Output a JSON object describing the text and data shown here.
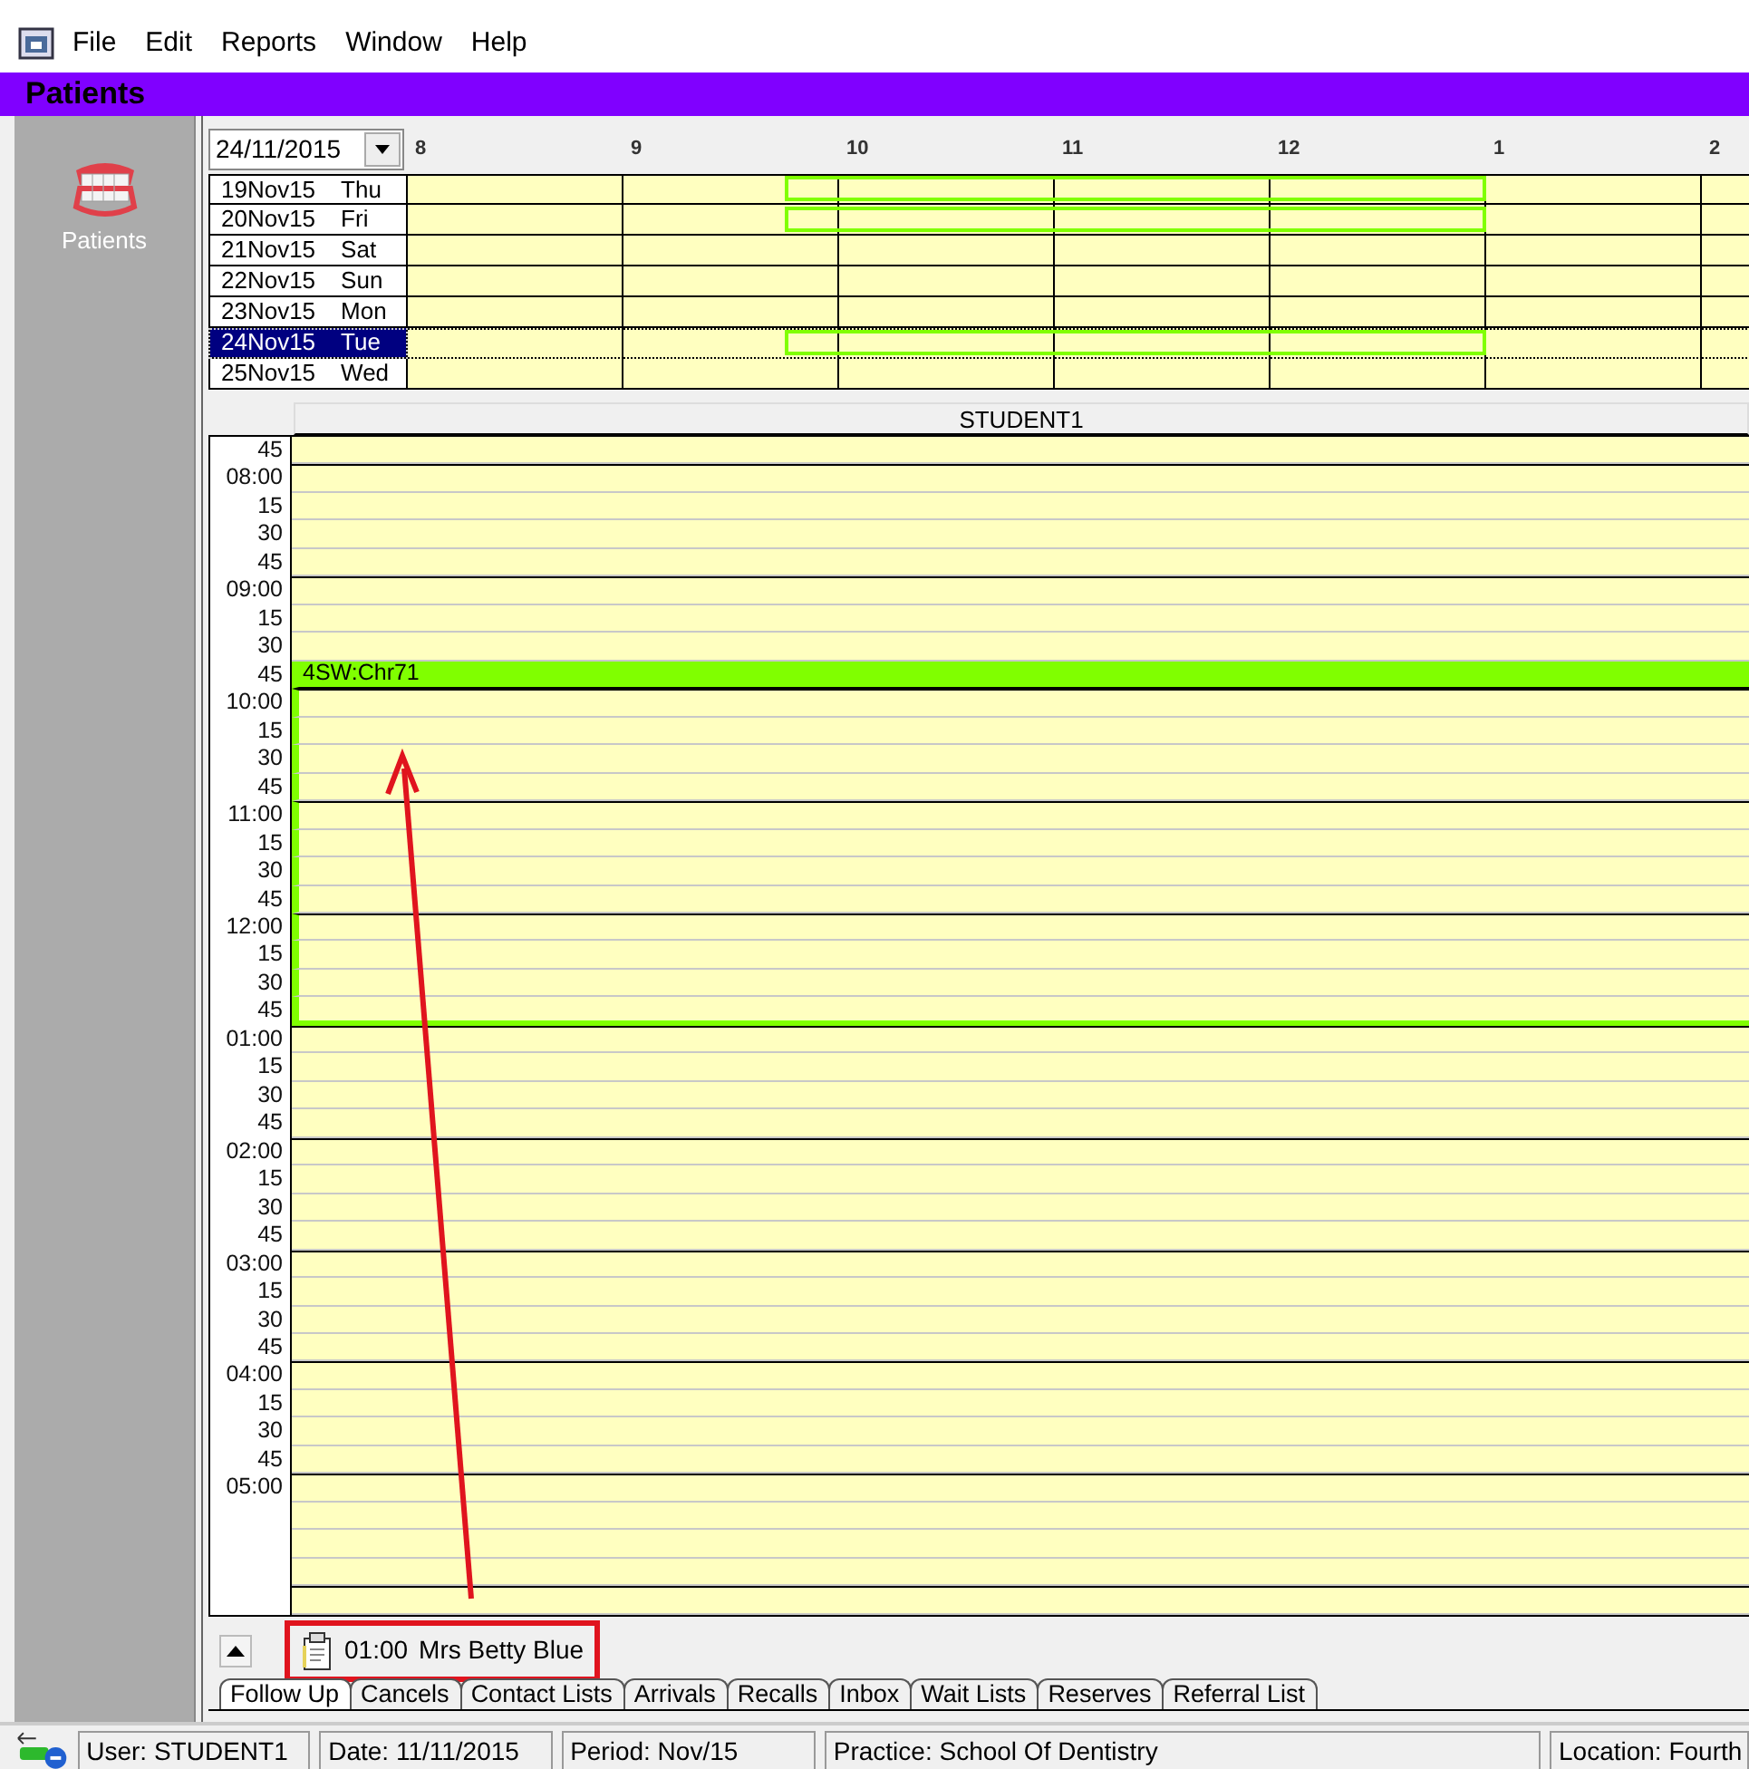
{
  "menu": [
    "File",
    "Edit",
    "Reports",
    "Window",
    "Help"
  ],
  "title": "Patients",
  "sidebar": {
    "items": [
      {
        "label": "Patients"
      }
    ]
  },
  "date_picker": {
    "value": "24/11/2015"
  },
  "hours": [
    "8",
    "9",
    "10",
    "11",
    "12",
    "1",
    "2"
  ],
  "days": [
    {
      "date": "19Nov15",
      "weekday": "Thu",
      "selected": false,
      "booked": true
    },
    {
      "date": "20Nov15",
      "weekday": "Fri",
      "selected": false,
      "booked": true
    },
    {
      "date": "21Nov15",
      "weekday": "Sat",
      "selected": false,
      "booked": false
    },
    {
      "date": "22Nov15",
      "weekday": "Sun",
      "selected": false,
      "booked": false
    },
    {
      "date": "23Nov15",
      "weekday": "Mon",
      "selected": false,
      "booked": false
    },
    {
      "date": "24Nov15",
      "weekday": "Tue",
      "selected": true,
      "booked": true
    },
    {
      "date": "25Nov15",
      "weekday": "Wed",
      "selected": false,
      "booked": false
    }
  ],
  "column_header": "STUDENT1",
  "appointment": {
    "label": "4SW:Chr71"
  },
  "slots": [
    {
      "label": "45",
      "kind": "quarter",
      "booked": false
    },
    {
      "label": "08:00",
      "kind": "hour",
      "booked": false
    },
    {
      "label": "15",
      "kind": "quarter",
      "booked": false
    },
    {
      "label": "30",
      "kind": "quarter",
      "booked": false
    },
    {
      "label": "45",
      "kind": "quarter",
      "booked": false
    },
    {
      "label": "09:00",
      "kind": "hour",
      "booked": false
    },
    {
      "label": "15",
      "kind": "quarter",
      "booked": false
    },
    {
      "label": "30",
      "kind": "quarter",
      "booked": false
    },
    {
      "label": "45",
      "kind": "quarter",
      "booked": true
    },
    {
      "label": "10:00",
      "kind": "hour",
      "booked": true
    },
    {
      "label": "15",
      "kind": "quarter",
      "booked": true
    },
    {
      "label": "30",
      "kind": "quarter",
      "booked": true
    },
    {
      "label": "45",
      "kind": "quarter",
      "booked": true
    },
    {
      "label": "11:00",
      "kind": "hour",
      "booked": true
    },
    {
      "label": "15",
      "kind": "quarter",
      "booked": true
    },
    {
      "label": "30",
      "kind": "quarter",
      "booked": true
    },
    {
      "label": "45",
      "kind": "quarter",
      "booked": true
    },
    {
      "label": "12:00",
      "kind": "hour",
      "booked": true
    },
    {
      "label": "15",
      "kind": "quarter",
      "booked": true
    },
    {
      "label": "30",
      "kind": "quarter",
      "booked": true
    },
    {
      "label": "45",
      "kind": "quarter",
      "booked": true
    },
    {
      "label": "01:00",
      "kind": "hour",
      "booked": false
    },
    {
      "label": "15",
      "kind": "quarter",
      "booked": false
    },
    {
      "label": "30",
      "kind": "quarter",
      "booked": false
    },
    {
      "label": "45",
      "kind": "quarter",
      "booked": false
    },
    {
      "label": "02:00",
      "kind": "hour",
      "booked": false
    },
    {
      "label": "15",
      "kind": "quarter",
      "booked": false
    },
    {
      "label": "30",
      "kind": "quarter",
      "booked": false
    },
    {
      "label": "45",
      "kind": "quarter",
      "booked": false
    },
    {
      "label": "03:00",
      "kind": "hour",
      "booked": false
    },
    {
      "label": "15",
      "kind": "quarter",
      "booked": false
    },
    {
      "label": "30",
      "kind": "quarter",
      "booked": false
    },
    {
      "label": "45",
      "kind": "quarter",
      "booked": false
    },
    {
      "label": "04:00",
      "kind": "hour",
      "booked": false
    },
    {
      "label": "15",
      "kind": "quarter",
      "booked": false
    },
    {
      "label": "30",
      "kind": "quarter",
      "booked": false
    },
    {
      "label": "45",
      "kind": "quarter",
      "booked": false
    },
    {
      "label": "05:00",
      "kind": "hour",
      "booked": false
    },
    {
      "kind": "quarter",
      "booked": false
    },
    {
      "kind": "quarter",
      "booked": false
    },
    {
      "kind": "quarter",
      "booked": false
    },
    {
      "kind": "hour",
      "booked": false
    }
  ],
  "follow_up": [
    {
      "time": "01:00",
      "name": "Mrs Betty Blue",
      "highlighted": true
    }
  ],
  "tabs": [
    {
      "label": "Follow Up",
      "selected": true
    },
    {
      "label": "Cancels",
      "selected": false
    },
    {
      "label": "Contact Lists",
      "selected": false
    },
    {
      "label": "Arrivals",
      "selected": false
    },
    {
      "label": "Recalls",
      "selected": false
    },
    {
      "label": "Inbox",
      "selected": false
    },
    {
      "label": "Wait Lists",
      "selected": false
    },
    {
      "label": "Reserves",
      "selected": false
    },
    {
      "label": "Referral List",
      "selected": false
    }
  ],
  "status_bar": [
    "User: STUDENT1",
    "Date: 11/11/2015",
    "Period: Nov/15",
    "Practice: School Of Dentistry",
    "Location: Fourth"
  ]
}
